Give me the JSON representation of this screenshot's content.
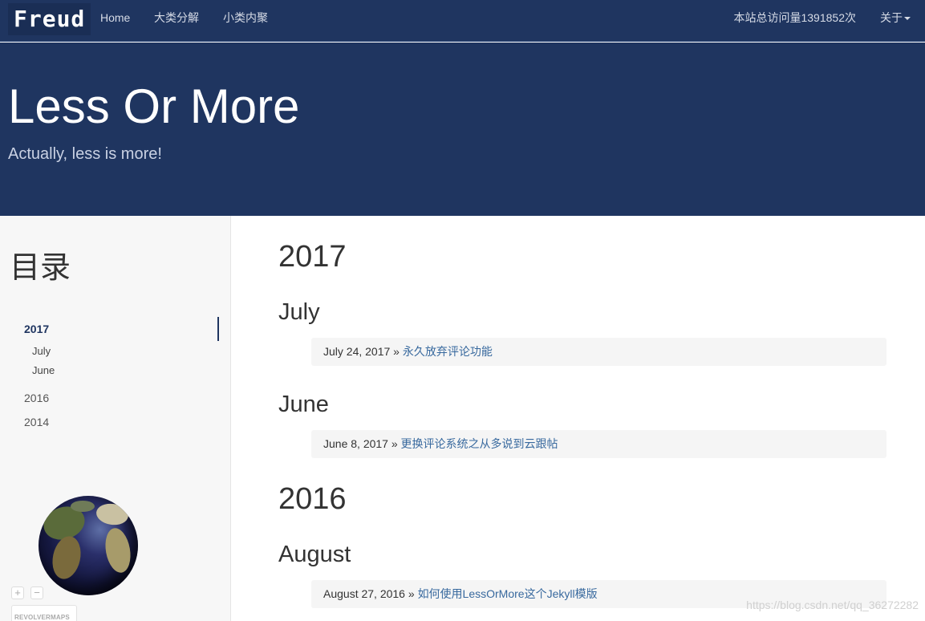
{
  "navbar": {
    "brand": "Freud",
    "links": [
      "Home",
      "大类分解",
      "小类内聚"
    ],
    "visits": "本站总访问量1391852次",
    "about": "关于"
  },
  "hero": {
    "title": "Less Or More",
    "subtitle": "Actually, less is more!"
  },
  "sidebar": {
    "title": "目录",
    "toc": {
      "y2017": "2017",
      "july": "July",
      "june": "June",
      "y2016": "2016",
      "y2014": "2014"
    },
    "widget": {
      "zoom_in": "+",
      "zoom_out": "−",
      "label": "REVOLVERMAPS"
    }
  },
  "main": {
    "year_2017": "2017",
    "month_july": "July",
    "post_1": {
      "date": "July 24, 2017",
      "sep": " » ",
      "title": "永久放弃评论功能"
    },
    "month_june": "June",
    "post_2": {
      "date": "June 8, 2017",
      "sep": " » ",
      "title": "更换评论系统之从多说到云跟帖"
    },
    "year_2016": "2016",
    "month_august": "August",
    "post_3": {
      "date": "August 27, 2016",
      "sep": " » ",
      "title": "如何使用LessOrMore这个Jekyll模版"
    }
  },
  "watermark": "https://blog.csdn.net/qq_36272282",
  "colors": {
    "header_bg": "#1f3560",
    "link": "#38699e",
    "sidebar_bg": "#f7f7f7"
  }
}
